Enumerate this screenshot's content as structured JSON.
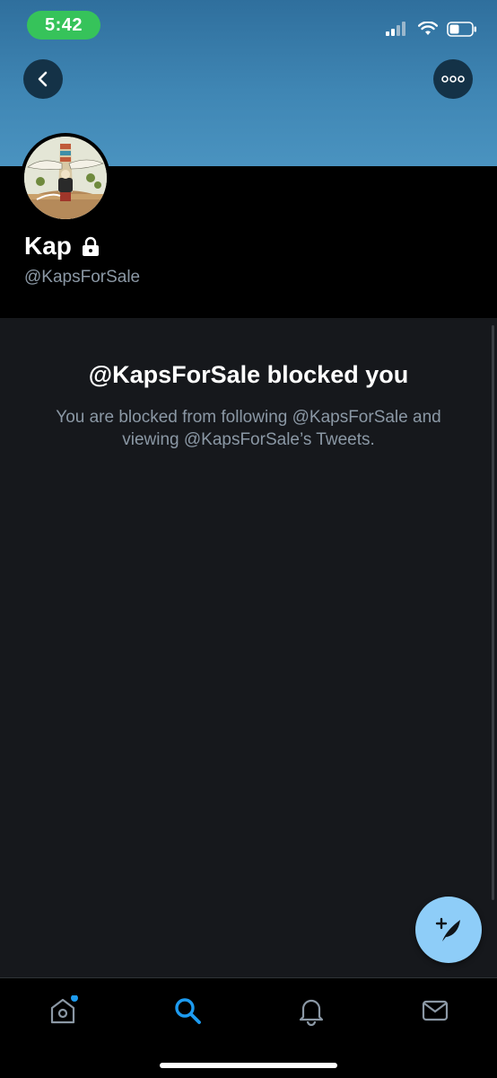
{
  "status_bar": {
    "time": "5:42",
    "signal_icon": "cellular-signal-icon",
    "wifi_icon": "wifi-icon",
    "battery_icon": "battery-icon"
  },
  "header": {
    "back_icon": "chevron-left-icon",
    "more_icon": "more-horizontal-icon",
    "banner_color": "#3f86b4"
  },
  "profile": {
    "display_name": "Kap",
    "protected_icon": "lock-icon",
    "handle": "@KapsForSale"
  },
  "blocked": {
    "title": "@KapsForSale blocked you",
    "description": "You are blocked from following @KapsForSale and viewing @KapsForSale’s Tweets."
  },
  "compose": {
    "icon": "compose-tweet-icon",
    "color": "#8ecdf8"
  },
  "tabs": [
    {
      "name": "home",
      "icon": "home-icon",
      "active": false,
      "has_notification_dot": true
    },
    {
      "name": "search",
      "icon": "search-icon",
      "active": true
    },
    {
      "name": "notifications",
      "icon": "bell-icon",
      "active": false
    },
    {
      "name": "messages",
      "icon": "mail-icon",
      "active": false
    }
  ],
  "colors": {
    "accent": "#1d9bf0",
    "panel_bg": "#16181c",
    "secondary_text": "#8b98a5"
  }
}
